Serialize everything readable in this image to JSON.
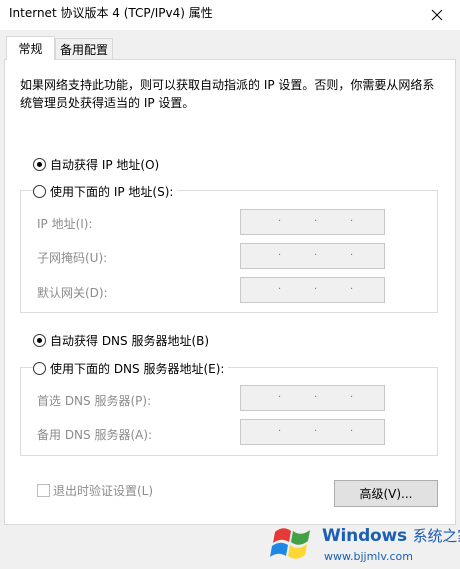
{
  "window": {
    "title": "Internet 协议版本 4 (TCP/IPv4) 属性"
  },
  "tabs": [
    {
      "label": "常规",
      "active": true
    },
    {
      "label": "备用配置",
      "active": false
    }
  ],
  "description": "如果网络支持此功能，则可以获取自动指派的 IP 设置。否则，你需要从网络系统管理员处获得适当的 IP 设置。",
  "ip": {
    "auto_label": "自动获得 IP 地址(O)",
    "auto_selected": true,
    "manual_label": "使用下面的 IP 地址(S):",
    "fields": [
      {
        "label": "IP 地址(I):",
        "value": ""
      },
      {
        "label": "子网掩码(U):",
        "value": ""
      },
      {
        "label": "默认网关(D):",
        "value": ""
      }
    ]
  },
  "dns": {
    "auto_label": "自动获得 DNS 服务器地址(B)",
    "auto_selected": true,
    "manual_label": "使用下面的 DNS 服务器地址(E):",
    "fields": [
      {
        "label": "首选 DNS 服务器(P):",
        "value": ""
      },
      {
        "label": "备用 DNS 服务器(A):",
        "value": ""
      }
    ]
  },
  "validate": {
    "label": "退出时验证设置(L)",
    "checked": false,
    "enabled": false
  },
  "advanced_button": "高级(V)...",
  "watermark": {
    "brand": "Windows",
    "suffix": "系统之家",
    "url": "www.bjjmlv.com"
  },
  "colors": {
    "watermark_blue": "#1a5fb4",
    "win_red": "#e53935",
    "win_green": "#43a047",
    "win_blue": "#1e88e5",
    "win_yellow": "#fdd835"
  },
  "icons": [
    "close-icon",
    "windows-logo-icon"
  ]
}
